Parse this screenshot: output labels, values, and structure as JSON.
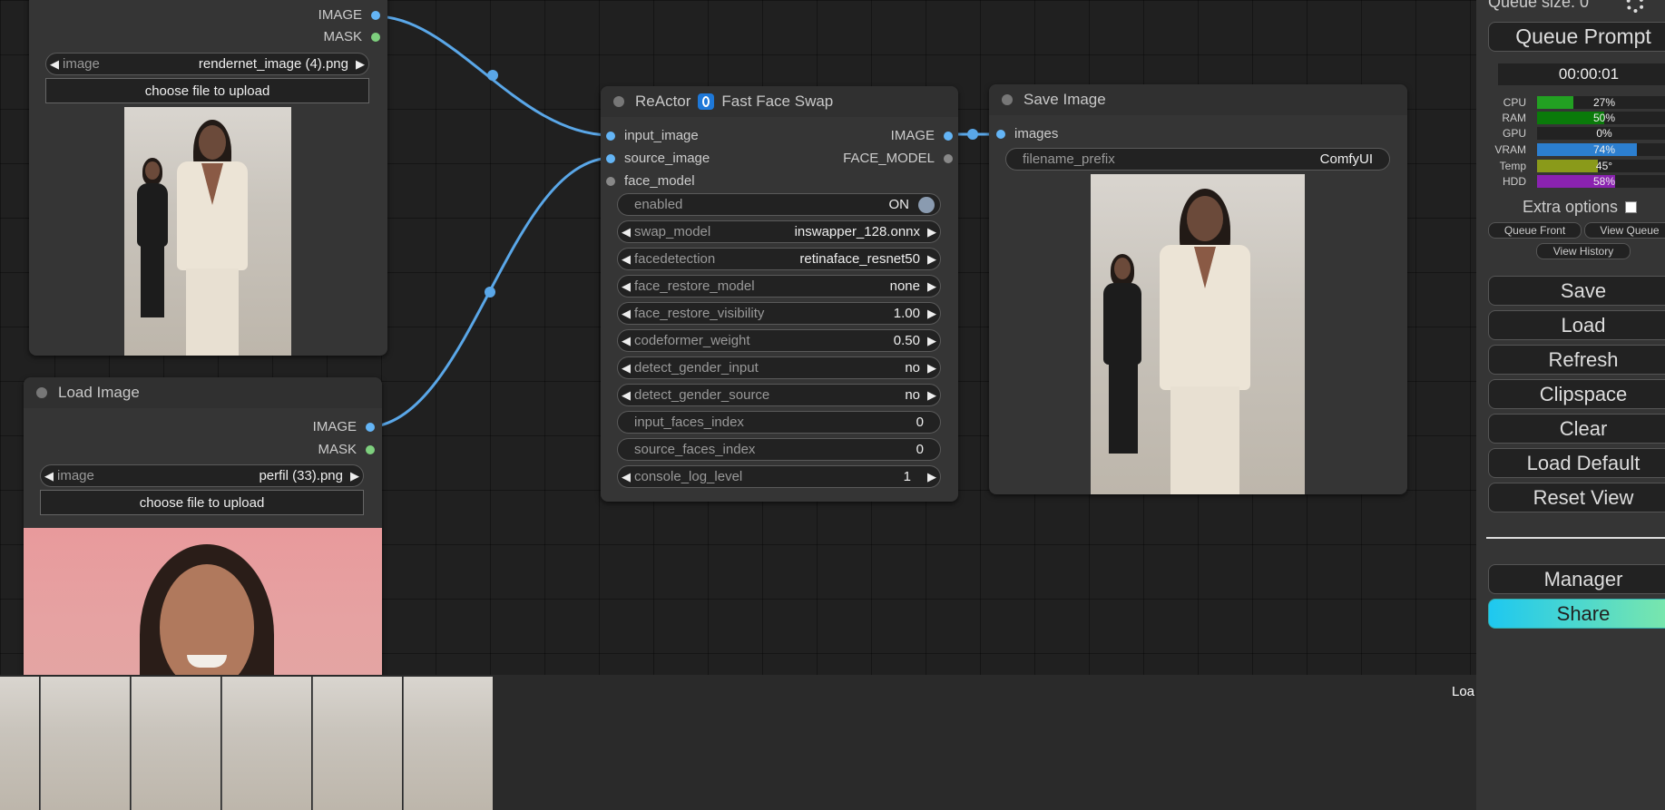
{
  "load_image_top": {
    "outputs": [
      "IMAGE",
      "MASK"
    ],
    "image_label": "image",
    "image_value": "rendernet_image (4).png",
    "upload_label": "choose file to upload"
  },
  "load_image_bottom": {
    "title": "Load Image",
    "outputs": [
      "IMAGE",
      "MASK"
    ],
    "image_label": "image",
    "image_value": "perfil (33).png",
    "upload_label": "choose file to upload"
  },
  "reactor": {
    "title_a": "ReActor",
    "title_b": "Fast Face Swap",
    "inputs": [
      "input_image",
      "source_image",
      "face_model"
    ],
    "outputs": [
      "IMAGE",
      "FACE_MODEL"
    ],
    "enabled_label": "enabled",
    "enabled_value": "ON",
    "widgets": [
      {
        "label": "swap_model",
        "value": "inswapper_128.onnx"
      },
      {
        "label": "facedetection",
        "value": "retinaface_resnet50"
      },
      {
        "label": "face_restore_model",
        "value": "none"
      },
      {
        "label": "face_restore_visibility",
        "value": "1.00"
      },
      {
        "label": "codeformer_weight",
        "value": "0.50"
      },
      {
        "label": "detect_gender_input",
        "value": "no"
      },
      {
        "label": "detect_gender_source",
        "value": "no"
      },
      {
        "label": "input_faces_index",
        "value": "0"
      },
      {
        "label": "source_faces_index",
        "value": "0"
      },
      {
        "label": "console_log_level",
        "value": "1"
      }
    ]
  },
  "save_image": {
    "title": "Save Image",
    "input": "images",
    "prefix_label": "filename_prefix",
    "prefix_value": "ComfyUI"
  },
  "sidebar": {
    "queue_size": "Queue size: 0",
    "queue_prompt": "Queue Prompt",
    "timer": "00:00:01",
    "stats": [
      {
        "label": "CPU",
        "pct": "27%",
        "value": 27,
        "color": "#22a022"
      },
      {
        "label": "RAM",
        "pct": "50%",
        "value": 50,
        "color": "#0a7a0a"
      },
      {
        "label": "GPU",
        "pct": "0%",
        "value": 0,
        "color": "#22a022"
      },
      {
        "label": "VRAM",
        "pct": "74%",
        "value": 74,
        "color": "#2c7fd0"
      },
      {
        "label": "Temp",
        "pct": "45°",
        "value": 45,
        "color": "#8a9a1a"
      },
      {
        "label": "HDD",
        "pct": "58%",
        "value": 58,
        "color": "#8a22b0"
      }
    ],
    "extra_options": "Extra options",
    "queue_front": "Queue Front",
    "view_queue": "View Queue",
    "view_history": "View History",
    "buttons": [
      "Save",
      "Load",
      "Refresh",
      "Clipspace",
      "Clear",
      "Load Default",
      "Reset View"
    ],
    "manager": "Manager",
    "share": "Share"
  },
  "bottom": {
    "loading_text": "Loa"
  },
  "colors": {
    "link": "#5aa7e8",
    "accent_share_start": "#1ec8f0",
    "accent_share_end": "#7fe8a8"
  }
}
